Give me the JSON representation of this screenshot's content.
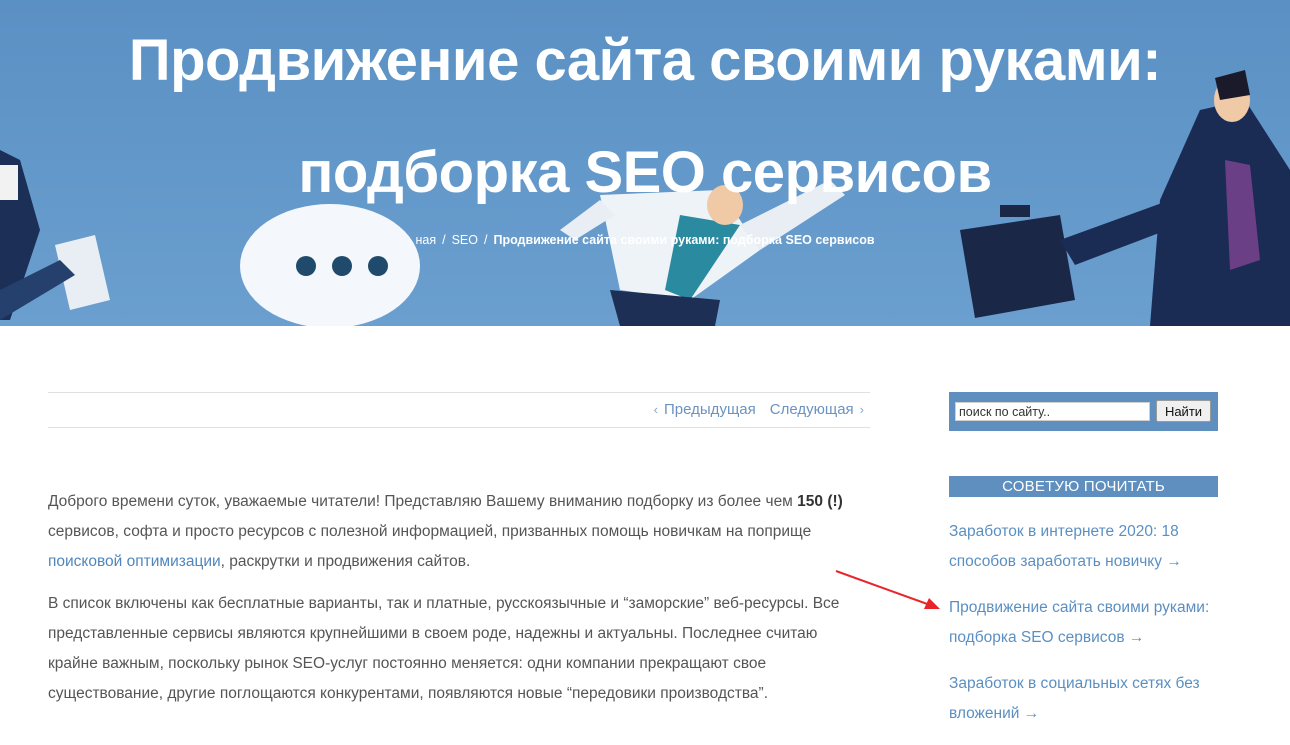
{
  "hero": {
    "title_line1": "Продвижение сайта своими руками:",
    "title_line2": "подборка SEO сервисов",
    "breadcrumb": {
      "home": "ная",
      "separator": "/",
      "category": "SEO",
      "current": "Продвижение сайта своими руками: подборка SEO сервисов"
    }
  },
  "post_nav": {
    "prev_label": "Предыдущая",
    "next_label": "Следующая",
    "prev_icon": "chevron-left-icon",
    "next_icon": "chevron-right-icon"
  },
  "article": {
    "p1_before": "Доброго времени суток, уважаемые читатели! Представляю Вашему вниманию подборку из более чем ",
    "p1_bold": "150 (!)",
    "p1_mid": " сервисов, софта и просто ресурсов с полезной информацией, призванных помощь новичкам на поприще ",
    "p1_link": "поисковой оптимизации",
    "p1_after": ", раскрутки и продвижения сайтов.",
    "p2": "В список включены как бесплатные варианты, так и платные, русскоязычные и “заморские” веб-ресурсы. Все представленные сервисы являются крупнейшими в своем роде, надежны и актуальны. Последнее считаю крайне важным, поскольку рынок SEO-услуг постоянно меняется: одни компании прекращают свое существование, другие поглощаются конкурентами, появляются новые “передовики производства”."
  },
  "sidebar": {
    "search": {
      "placeholder": "поиск по сайту..",
      "button_label": "Найти"
    },
    "widget_title": "СОВЕТУЮ ПОЧИТАТЬ",
    "items": [
      {
        "label": "Заработок в интернете 2020: 18 способов заработать новичку →"
      },
      {
        "label": "Продвижение сайта своими руками: подборка SEO сервисов →"
      },
      {
        "label": "Заработок в социальных сетях без вложений →"
      }
    ]
  },
  "colors": {
    "hero_bg": "#5b90c4",
    "accent": "#5e8fbe",
    "link": "#5b8fc2",
    "annotation_arrow": "#e8262a"
  }
}
